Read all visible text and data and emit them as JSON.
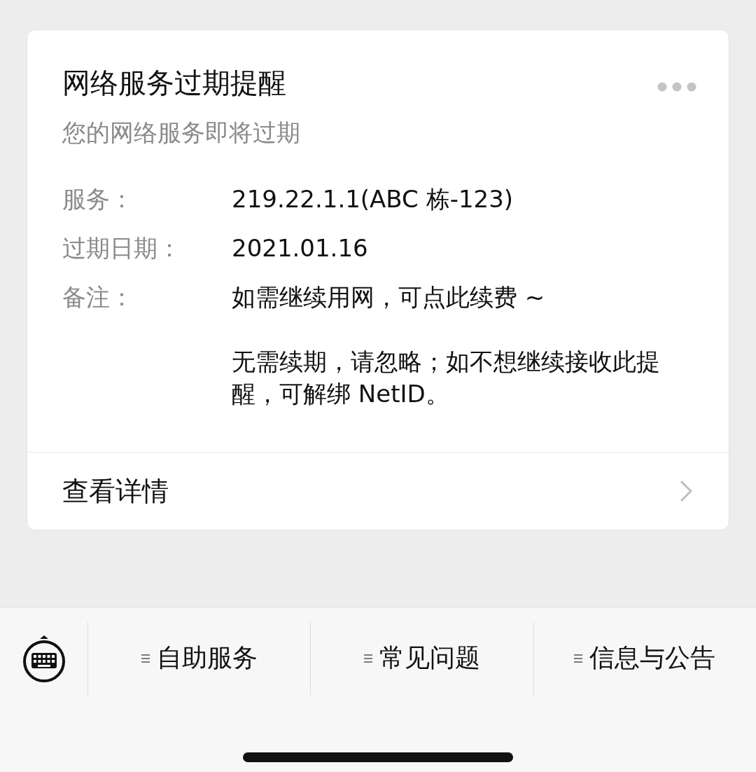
{
  "card": {
    "title": "网络服务过期提醒",
    "subtitle": "您的网络服务即将过期",
    "fields": [
      {
        "label": "服务：",
        "value": [
          "219.22.1.1(ABC 栋-123)"
        ]
      },
      {
        "label": "过期日期：",
        "value": [
          "2021.01.16"
        ]
      },
      {
        "label": "备注：",
        "value": [
          "如需继续用网，可点此续费 ~",
          "无需续期，请忽略；如不想继续接收此提醒，可解绑 NetID。"
        ]
      }
    ],
    "details_link": "查看详情"
  },
  "menu": [
    "自助服务",
    "常见问题",
    "信息与公告"
  ]
}
